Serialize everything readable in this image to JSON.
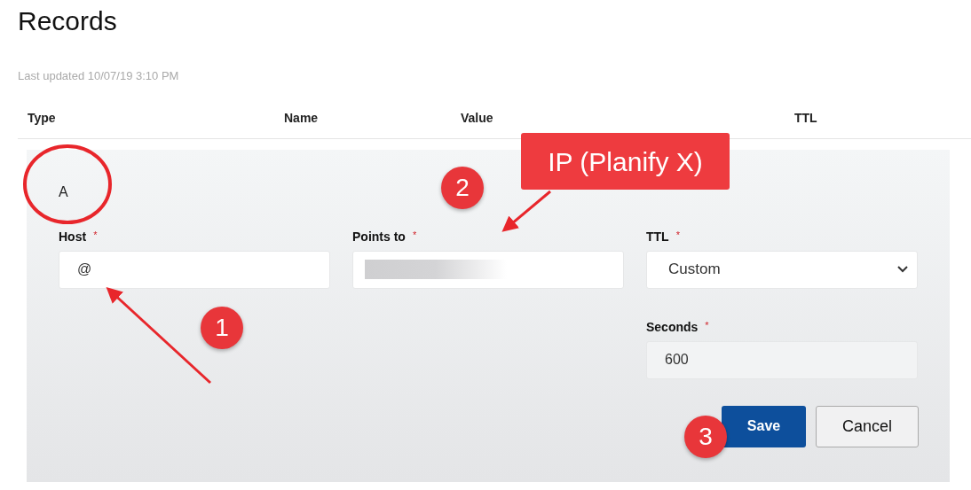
{
  "page": {
    "title": "Records",
    "last_updated": "Last updated 10/07/19 3:10 PM"
  },
  "table": {
    "columns": [
      "Type",
      "Name",
      "Value",
      "TTL"
    ]
  },
  "record_form": {
    "type": "A",
    "fields": [
      {
        "kind": "text",
        "label": "Host",
        "required_mark": "*",
        "value": "@"
      },
      {
        "kind": "redacted",
        "label": "Points to",
        "required_mark": "*"
      },
      {
        "kind": "select",
        "label": "TTL",
        "required_mark": "*",
        "value": "Custom"
      },
      {
        "kind": "text",
        "label": "Seconds",
        "required_mark": "*",
        "value": "600"
      }
    ],
    "buttons": [
      {
        "kind": "primary",
        "label": "Save"
      },
      {
        "kind": "secondary",
        "label": "Cancel"
      }
    ]
  },
  "annotations": {
    "callout": "IP (Planify X)",
    "badges": [
      "1",
      "2",
      "3"
    ]
  }
}
